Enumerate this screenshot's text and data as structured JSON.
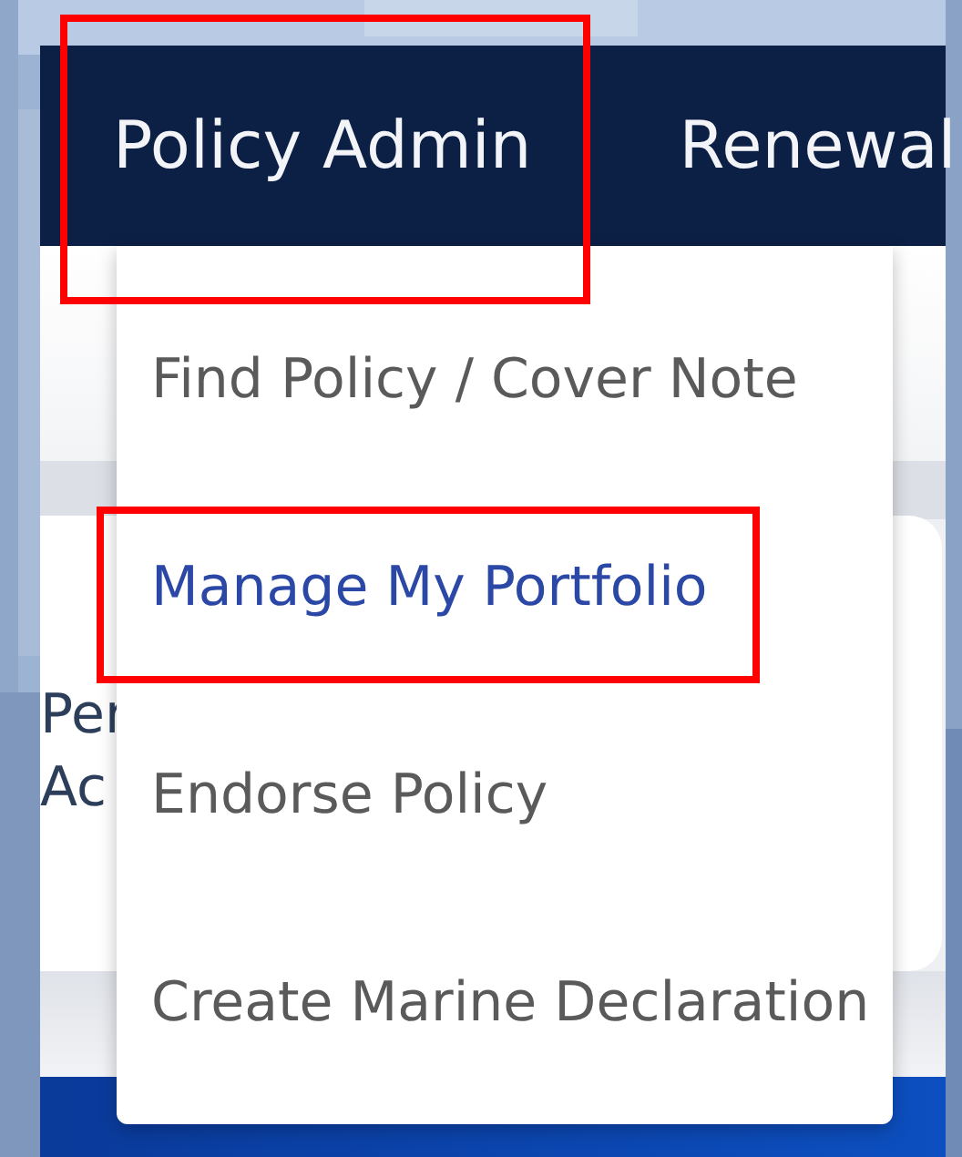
{
  "nav": {
    "items": [
      {
        "label": "Policy Admin",
        "highlighted": true
      },
      {
        "label": "Renewal",
        "highlighted": false
      }
    ]
  },
  "menu": {
    "items": [
      {
        "label": "Find Policy / Cover Note",
        "selected": false,
        "highlighted": false
      },
      {
        "label": "Manage My Portfolio",
        "selected": true,
        "highlighted": true
      },
      {
        "label": "Endorse Policy",
        "selected": false,
        "highlighted": false
      },
      {
        "label": "Create Marine Declaration",
        "selected": false,
        "highlighted": false
      }
    ]
  },
  "card": {
    "lines": [
      "Per",
      "Ac"
    ]
  }
}
